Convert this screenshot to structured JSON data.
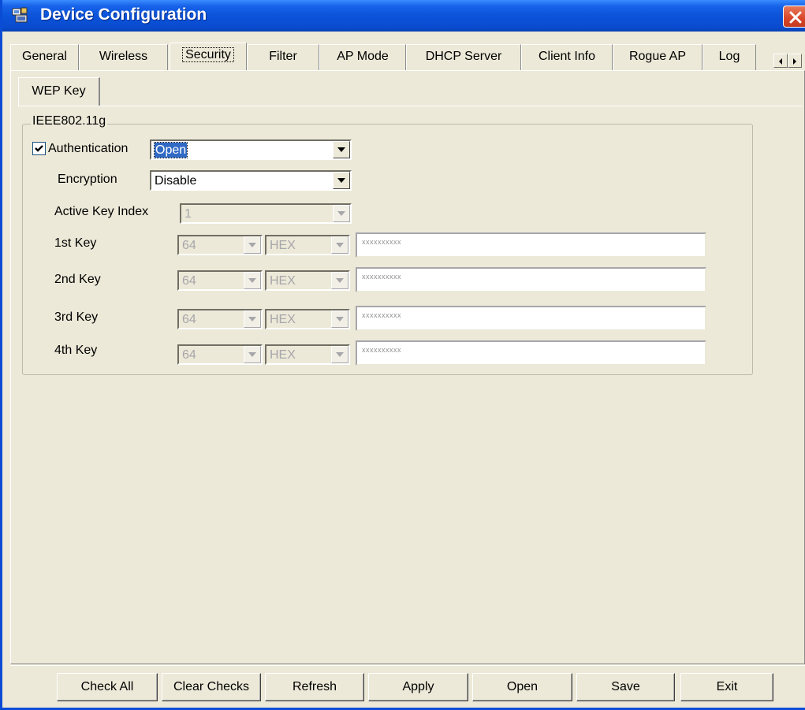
{
  "window": {
    "title": "Device Configuration",
    "title_icon": "device-config-icon",
    "close_icon": "close-icon"
  },
  "tabs": [
    {
      "label": "General"
    },
    {
      "label": "Wireless"
    },
    {
      "label": "Security",
      "active": true
    },
    {
      "label": "Filter"
    },
    {
      "label": "AP Mode"
    },
    {
      "label": "DHCP Server"
    },
    {
      "label": "Client Info"
    },
    {
      "label": "Rogue AP"
    },
    {
      "label": "Log"
    }
  ],
  "subtab": {
    "label": "WEP Key"
  },
  "group": {
    "label": "IEEE802.11g",
    "authentication": {
      "label": "Authentication",
      "checked": true,
      "value": "Open"
    },
    "encryption": {
      "label": "Encryption",
      "value": "Disable"
    },
    "active_key_index": {
      "label": "Active Key Index",
      "value": "1"
    },
    "keys": [
      {
        "label": "1st Key",
        "length": "64",
        "format": "HEX",
        "value": "xxxxxxxxxx"
      },
      {
        "label": "2nd Key",
        "length": "64",
        "format": "HEX",
        "value": "xxxxxxxxxx"
      },
      {
        "label": "3rd Key",
        "length": "64",
        "format": "HEX",
        "value": "xxxxxxxxxx"
      },
      {
        "label": "4th Key",
        "length": "64",
        "format": "HEX",
        "value": "xxxxxxxxxx"
      }
    ]
  },
  "buttons": {
    "check_all": "Check All",
    "clear_checks": "Clear Checks",
    "refresh": "Refresh",
    "apply": "Apply",
    "open": "Open",
    "save": "Save",
    "exit": "Exit"
  },
  "colors": {
    "titlebar": "#0a52d8",
    "face": "#ece9d8",
    "highlight": "#316ac5",
    "close": "#d9452a"
  }
}
